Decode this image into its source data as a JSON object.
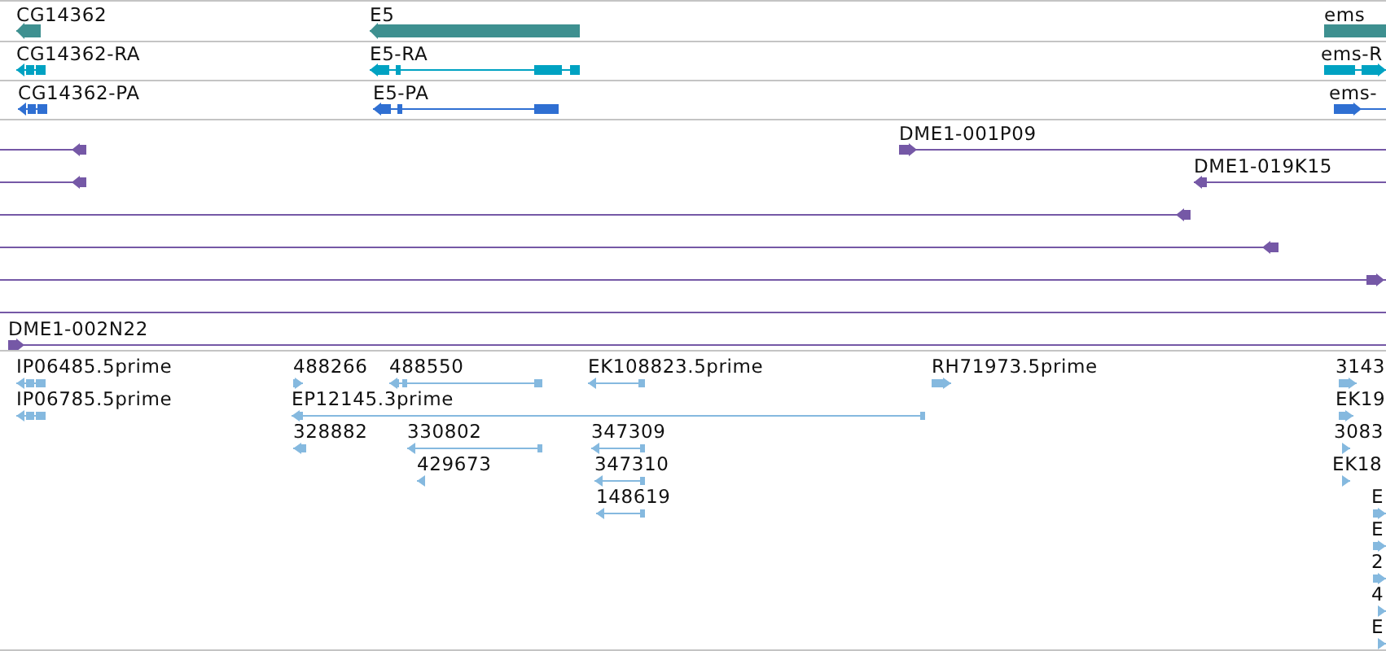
{
  "tracks": [
    {
      "kind": "gene",
      "features": [
        {
          "label": "CG14362",
          "points_left": true,
          "points_right": false
        },
        {
          "label": "E5",
          "points_left": true,
          "points_right": false
        },
        {
          "label": "ems",
          "points_left": false,
          "points_right": false
        }
      ]
    },
    {
      "kind": "transcript",
      "features": [
        {
          "label": "CG14362-RA",
          "points_left": true,
          "points_right": false
        },
        {
          "label": "E5-RA",
          "points_left": true,
          "points_right": false
        },
        {
          "label": "ems-R",
          "points_left": false,
          "points_right": true
        }
      ]
    },
    {
      "kind": "protein",
      "features": [
        {
          "label": "CG14362-PA",
          "points_left": true,
          "points_right": false
        },
        {
          "label": "E5-PA",
          "points_left": true,
          "points_right": false
        },
        {
          "label": "ems-",
          "points_left": false,
          "points_right": true
        }
      ]
    },
    {
      "kind": "clone",
      "features": [
        {
          "points_left": true,
          "points_right": false
        },
        {
          "label": "DME1-001P09",
          "points_left": false,
          "points_right": true
        },
        {
          "points_left": true,
          "points_right": false
        },
        {
          "label": "DME1-019K15",
          "points_left": true,
          "points_right": false
        },
        {
          "points_left": true,
          "points_right": false
        },
        {
          "points_left": true,
          "points_right": false
        },
        {
          "points_left": false,
          "points_right": true
        },
        {
          "points_left": false,
          "points_right": false
        },
        {
          "label": "DME1-002N22",
          "points_left": false,
          "points_right": true
        }
      ]
    },
    {
      "kind": "est",
      "features": [
        {
          "label": "IP06485.5prime",
          "points_left": true,
          "points_right": false
        },
        {
          "label": "488266",
          "points_left": false,
          "points_right": true
        },
        {
          "label": "488550",
          "points_left": true,
          "points_right": false
        },
        {
          "label": "EK108823.5prime",
          "points_left": true,
          "points_right": false
        },
        {
          "label": "RH71973.5prime",
          "points_left": false,
          "points_right": true
        },
        {
          "label": "3143",
          "points_left": false,
          "points_right": true
        },
        {
          "label": "IP06785.5prime",
          "points_left": true,
          "points_right": false
        },
        {
          "label": "EP12145.3prime",
          "points_left": true,
          "points_right": false
        },
        {
          "label": "EK19",
          "points_left": false,
          "points_right": true
        },
        {
          "label": "328882",
          "points_left": true,
          "points_right": false
        },
        {
          "label": "330802",
          "points_left": true,
          "points_right": false
        },
        {
          "label": "347309",
          "points_left": true,
          "points_right": false
        },
        {
          "label": "3083",
          "points_left": false,
          "points_right": true
        },
        {
          "label": "429673",
          "points_left": true,
          "points_right": false
        },
        {
          "label": "347310",
          "points_left": true,
          "points_right": false
        },
        {
          "label": "EK18",
          "points_left": false,
          "points_right": true
        },
        {
          "label": "148619",
          "points_left": true,
          "points_right": false
        },
        {
          "label": "E",
          "points_left": false,
          "points_right": true
        },
        {
          "label": "E",
          "points_left": false,
          "points_right": true
        },
        {
          "label": "2",
          "points_left": false,
          "points_right": true
        },
        {
          "label": "4",
          "points_left": false,
          "points_right": true
        },
        {
          "label": "E",
          "points_left": false,
          "points_right": true
        }
      ]
    }
  ]
}
